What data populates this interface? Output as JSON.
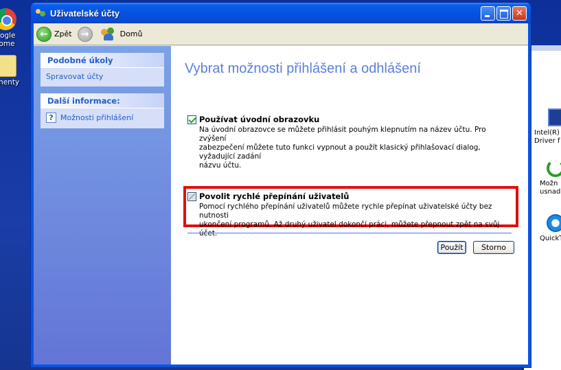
{
  "window": {
    "title": "Uživatelské účty"
  },
  "toolbar": {
    "back_label": "Zpět",
    "home_label": "Domů"
  },
  "taskpane": {
    "related": {
      "header": "Podobné úkoly",
      "links": [
        "Spravovat účty"
      ]
    },
    "info": {
      "header": "Další informace:",
      "links": [
        "Možnosti přihlášení"
      ]
    }
  },
  "main": {
    "title": "Vybrat možnosti přihlášení a odhlášení",
    "options": [
      {
        "label": "Používat úvodní obrazovku",
        "checked": true,
        "lines": [
          "Na úvodní obrazovce se můžete přihlásit pouhým klepnutím na název účtu. Pro zvýšení",
          "zabezpečení můžete tuto funkci vypnout a použít klasický přihlašovací dialog, vyžadující zadání",
          "názvu účtu."
        ]
      },
      {
        "label": "Povolit rychlé přepínání uživatelů",
        "checked": false,
        "lines": [
          "Pomocí rychlého přepínání uživatelů můžete rychle přepínat uživatelské účty bez nutnosti",
          "ukončení programů. Až druhý uživatel dokončí práci, můžete přepnout zpět na svůj účet."
        ]
      }
    ],
    "apply_label": "Použít",
    "cancel_label": "Storno"
  },
  "desktop": {
    "left_icons": [
      "oogle",
      "rome",
      "ументy"
    ],
    "right_items": [
      {
        "lines": [
          "Intel(R)",
          "Driver f"
        ]
      },
      {
        "lines": [
          "Možn",
          "usnad"
        ]
      },
      {
        "lines": [
          "QuickT"
        ]
      }
    ]
  },
  "colors": {
    "title_blue": "#5a7edc",
    "highlight_red": "#e01010",
    "xp_blue": "#0a53e0"
  }
}
